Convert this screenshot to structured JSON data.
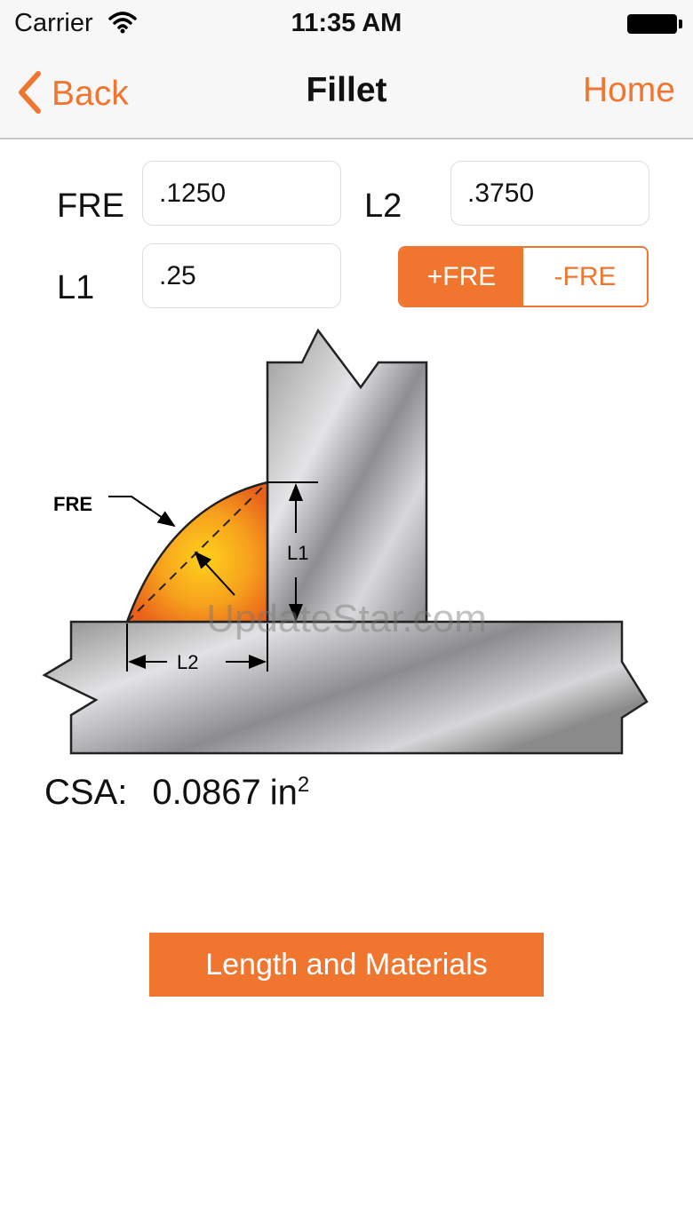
{
  "status_bar": {
    "carrier": "Carrier",
    "time": "11:35 AM"
  },
  "nav": {
    "back_label": "Back",
    "title": "Fillet",
    "home_label": "Home"
  },
  "fields": {
    "fre": {
      "label": "FRE",
      "value": ".1250"
    },
    "l2": {
      "label": "L2",
      "value": ".3750"
    },
    "l1": {
      "label": "L1",
      "value": ".25"
    }
  },
  "segmented": {
    "options": [
      "+FRE",
      "-FRE"
    ],
    "selected": "+FRE"
  },
  "diagram": {
    "labels": {
      "fre": "FRE",
      "l1": "L1",
      "l2": "L2"
    }
  },
  "watermark": "UpdateStar.com",
  "result": {
    "label": "CSA:",
    "value": "0.0867",
    "unit": "in",
    "unit_power": "2"
  },
  "action": {
    "label": "Length and Materials"
  },
  "colors": {
    "accent": "#f07630",
    "nav_background": "#f7f7f7"
  }
}
